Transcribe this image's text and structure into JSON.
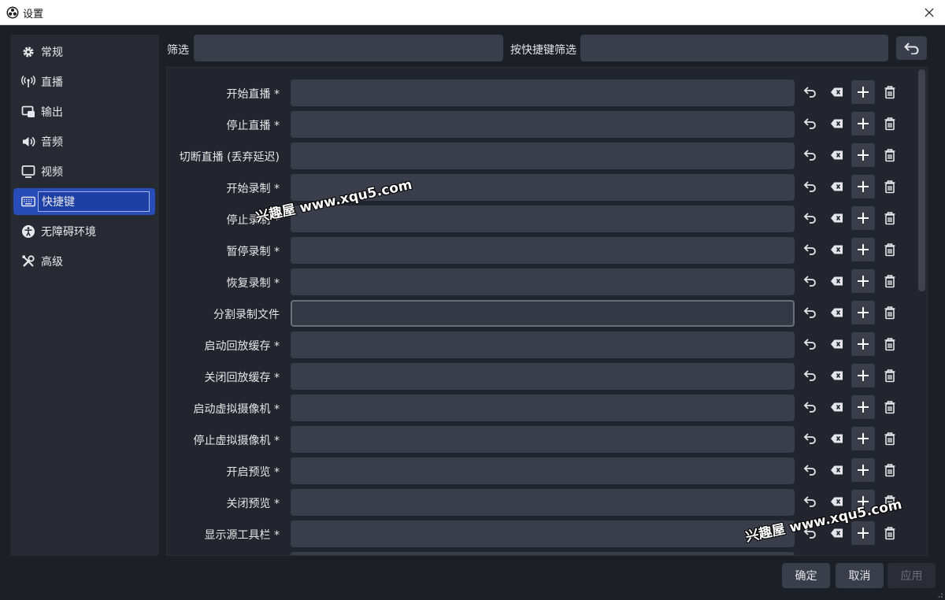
{
  "window": {
    "title": "设置"
  },
  "sidebar": {
    "items": [
      {
        "label": "常规",
        "icon": "gear-icon"
      },
      {
        "label": "直播",
        "icon": "antenna-icon"
      },
      {
        "label": "输出",
        "icon": "output-icon"
      },
      {
        "label": "音频",
        "icon": "speaker-icon"
      },
      {
        "label": "视频",
        "icon": "monitor-icon"
      },
      {
        "label": "快捷键",
        "icon": "keyboard-icon",
        "active": true
      },
      {
        "label": "无障碍环境",
        "icon": "accessibility-icon"
      },
      {
        "label": "高级",
        "icon": "tools-icon"
      }
    ]
  },
  "filter": {
    "label": "筛选",
    "value": "",
    "hotkey_label": "按快捷键筛选",
    "hotkey_value": ""
  },
  "hotkeys": [
    {
      "label": "开始直播 *"
    },
    {
      "label": "停止直播 *"
    },
    {
      "label": "切断直播 (丢弃延迟)"
    },
    {
      "label": "开始录制 *"
    },
    {
      "label": "停止录制 *"
    },
    {
      "label": "暂停录制 *"
    },
    {
      "label": "恢复录制 *"
    },
    {
      "label": "分割录制文件",
      "focused": true
    },
    {
      "label": "启动回放缓存 *"
    },
    {
      "label": "关闭回放缓存 *"
    },
    {
      "label": "启动虚拟摄像机 *"
    },
    {
      "label": "停止虚拟摄像机 *"
    },
    {
      "label": "开启预览 *"
    },
    {
      "label": "关闭预览 *"
    },
    {
      "label": "显示源工具栏 *"
    }
  ],
  "buttons": {
    "ok": "确定",
    "cancel": "取消",
    "apply": "应用"
  },
  "watermarks": [
    "兴趣屋 www.xqu5.com",
    "兴趣屋 www.xqu5.com"
  ],
  "colors": {
    "background": "#1d1f26",
    "panel": "#272a33",
    "input": "#3a3e4a",
    "accent": "#284cb8"
  }
}
